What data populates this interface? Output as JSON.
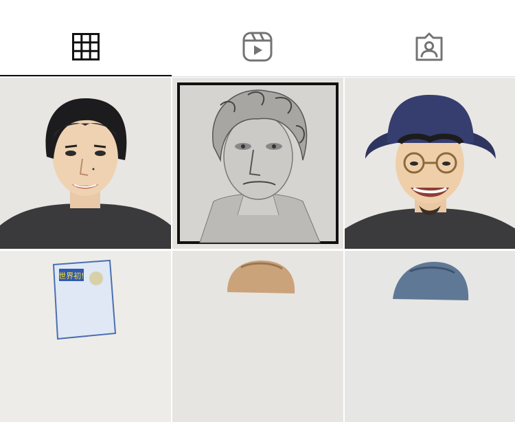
{
  "tabs": [
    {
      "icon": "grid-icon",
      "active": true
    },
    {
      "icon": "reels-icon",
      "active": false
    },
    {
      "icon": "tagged-icon",
      "active": false
    }
  ],
  "colors": {
    "active_icon": "#111111",
    "inactive_icon": "#737373",
    "divider": "#dbdbdb",
    "active_indicator": "#111111"
  },
  "posts": [
    {
      "subject": "man-dark-hair"
    },
    {
      "subject": "pencil-sketch-portrait"
    },
    {
      "subject": "man-bucket-hat-glasses"
    },
    {
      "subject": "snack-package"
    },
    {
      "subject": "portrait-light-hair"
    },
    {
      "subject": "portrait-blue"
    }
  ],
  "grid_package_text": "世界初!"
}
